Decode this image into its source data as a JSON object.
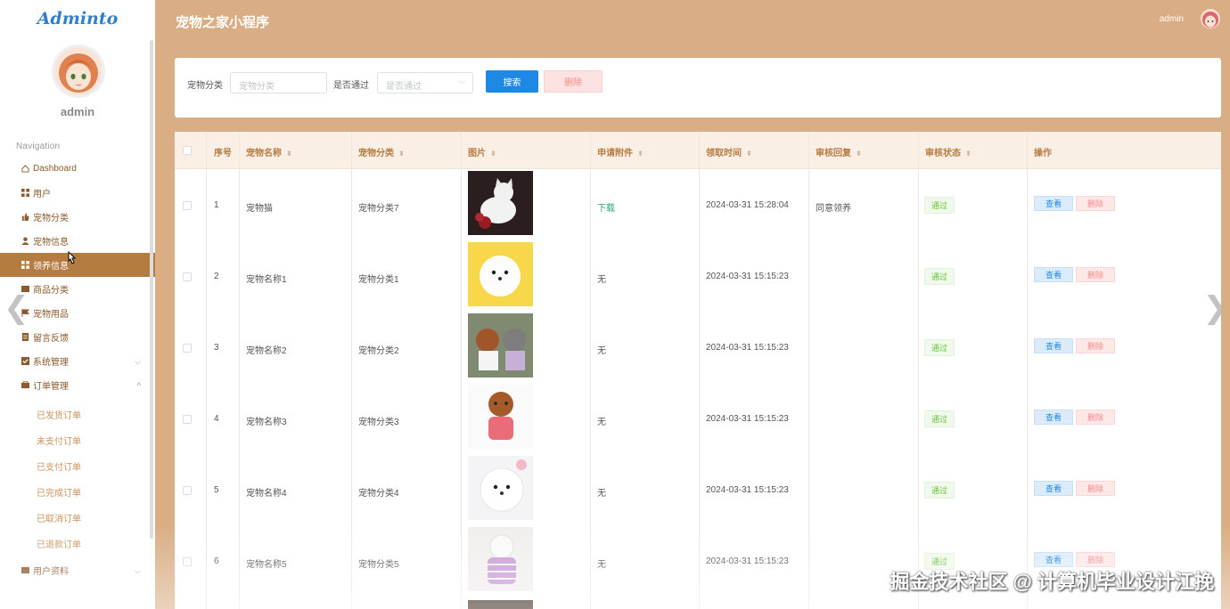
{
  "app": {
    "logo": "Adminto",
    "title": "宠物之家小程序",
    "user": "admin"
  },
  "sidebar": {
    "user_name": "admin",
    "nav_title": "Navigation",
    "items": [
      {
        "label": "Dashboard",
        "icon": "home-icon"
      },
      {
        "label": "用户",
        "icon": "grid-icon"
      },
      {
        "label": "宠物分类",
        "icon": "thumb-icon"
      },
      {
        "label": "宠物信息",
        "icon": "person-icon"
      },
      {
        "label": "领养信息",
        "icon": "grid-icon",
        "active": true
      },
      {
        "label": "商品分类",
        "icon": "folder-icon"
      },
      {
        "label": "宠物用品",
        "icon": "flag-icon"
      },
      {
        "label": "留言反馈",
        "icon": "doc-icon"
      },
      {
        "label": "系统管理",
        "icon": "check-icon",
        "chevron": "down"
      },
      {
        "label": "订单管理",
        "icon": "cart-icon",
        "chevron": "up"
      }
    ],
    "sub_items": [
      "已发货订单",
      "未支付订单",
      "已支付订单",
      "已完成订单",
      "已取消订单",
      "已退款订单"
    ],
    "last_item": {
      "label": "用户资料",
      "icon": "folder-icon",
      "chevron": "down"
    }
  },
  "search": {
    "category_label": "宠物分类",
    "category_placeholder": "宠物分类",
    "pass_label": "是否通过",
    "pass_placeholder": "是否通过",
    "search_button": "搜索",
    "delete_button": "删除"
  },
  "table": {
    "headers": [
      "序号",
      "宠物名称",
      "宠物分类",
      "图片",
      "申请附件",
      "领取时间",
      "审核回复",
      "审核状态",
      "操作"
    ],
    "rows": [
      {
        "no": "1",
        "name": "宠物猫",
        "category": "宠物分类7",
        "attachment": "下载",
        "time": "2024-03-31 15:28:04",
        "reply": "同意领养",
        "status": "通过"
      },
      {
        "no": "2",
        "name": "宠物名称1",
        "category": "宠物分类1",
        "attachment": "无",
        "time": "2024-03-31 15:15:23",
        "reply": "",
        "status": "通过"
      },
      {
        "no": "3",
        "name": "宠物名称2",
        "category": "宠物分类2",
        "attachment": "无",
        "time": "2024-03-31 15:15:23",
        "reply": "",
        "status": "通过"
      },
      {
        "no": "4",
        "name": "宠物名称3",
        "category": "宠物分类3",
        "attachment": "无",
        "time": "2024-03-31 15:15:23",
        "reply": "",
        "status": "通过"
      },
      {
        "no": "5",
        "name": "宠物名称4",
        "category": "宠物分类4",
        "attachment": "无",
        "time": "2024-03-31 15:15:23",
        "reply": "",
        "status": "通过"
      },
      {
        "no": "6",
        "name": "宠物名称5",
        "category": "宠物分类5",
        "attachment": "无",
        "time": "2024-03-31 15:15:23",
        "reply": "",
        "status": "通过"
      }
    ],
    "view_label": "查看",
    "delete_label": "删除"
  },
  "watermark": "掘金技术社区 @ 计算机毕业设计江挽",
  "colors": {
    "header_bg": "#d9ae84",
    "active_nav": "#b57c42",
    "primary": "#1e88e5",
    "success": "#67c23a"
  }
}
